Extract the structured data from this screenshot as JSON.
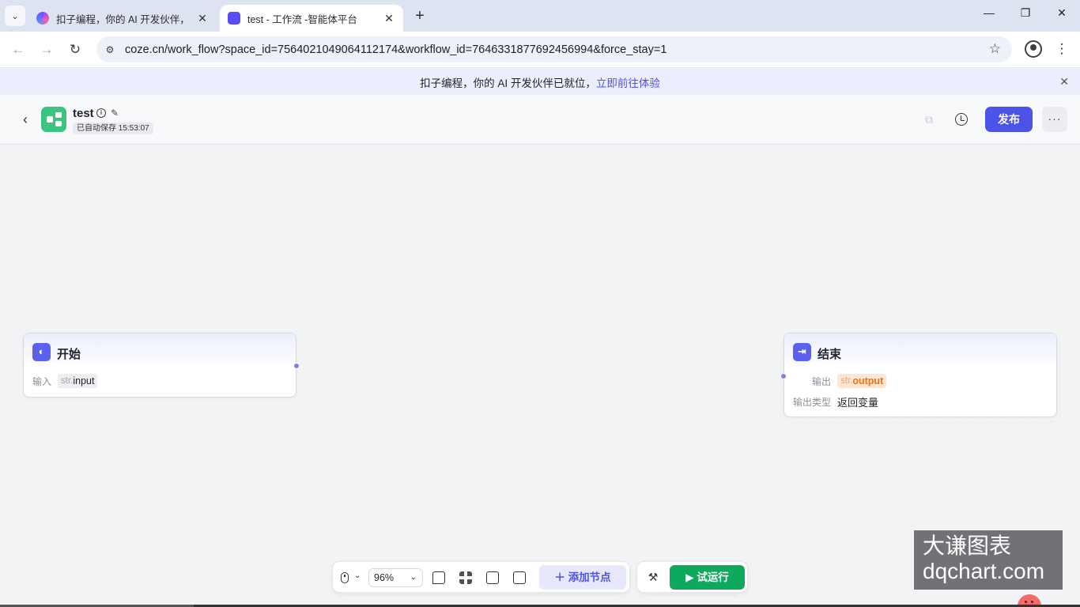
{
  "browser": {
    "tabs": [
      {
        "title": "扣子编程，你的 AI 开发伙伴，",
        "close": "✕",
        "active": false
      },
      {
        "title": "test - 工作流 -智能体平台",
        "close": "✕",
        "active": true
      }
    ],
    "new_tab": "+",
    "url": "coze.cn/work_flow?space_id=7564021049064112174&workflow_id=7646331877692456994&force_stay=1",
    "window_controls": {
      "minimize": "—",
      "restore": "❐",
      "close": "✕"
    }
  },
  "banner": {
    "text": "扣子编程，你的 AI 开发伙伴已就位，",
    "link": "立即前往体验",
    "close": "✕"
  },
  "header": {
    "back": "‹",
    "workflow_name": "test",
    "autosave": "已自动保存 15:53:07",
    "publish_label": "发布",
    "more": "···"
  },
  "nodes": {
    "start": {
      "title": "开始",
      "input_label": "输入",
      "param_type": "str.",
      "param_name": "input"
    },
    "end": {
      "title": "结束",
      "output_label": "输出",
      "param_type": "str.",
      "param_name": "output",
      "output_type_label": "输出类型",
      "output_type_value": "返回变量"
    }
  },
  "toolbar": {
    "zoom_value": "96%",
    "add_node_label": "添加节点",
    "run_label": "试运行"
  },
  "watermark": {
    "line1": "大谦图表",
    "line2": "dqchart.com"
  },
  "colors": {
    "brand": "#4d53e8",
    "run": "#0ea95c",
    "node_icon": "#5b61ee",
    "workflow_icon": "#3cc480"
  }
}
